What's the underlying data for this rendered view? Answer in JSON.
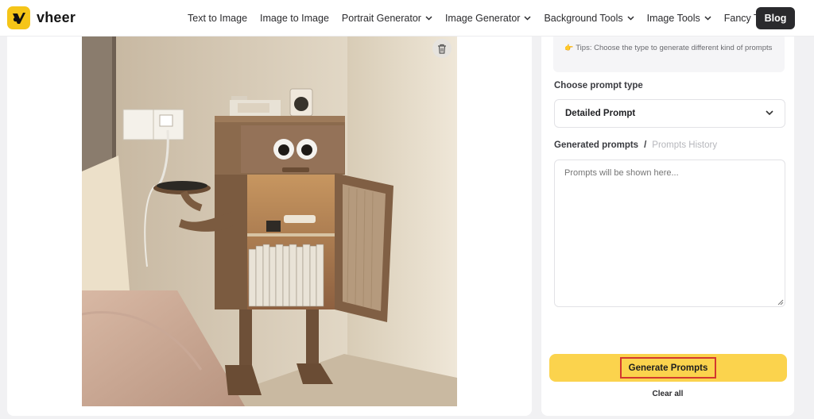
{
  "brand": {
    "name": "vheer",
    "accent": "#f5c518"
  },
  "nav": {
    "items": [
      {
        "label": "Text to Image",
        "dropdown": false
      },
      {
        "label": "Image to Image",
        "dropdown": false
      },
      {
        "label": "Portrait Generator",
        "dropdown": true
      },
      {
        "label": "Image Generator",
        "dropdown": true
      },
      {
        "label": "Background Tools",
        "dropdown": true
      },
      {
        "label": "Image Tools",
        "dropdown": true
      },
      {
        "label": "Fancy Text",
        "dropdown": true
      }
    ],
    "blog_label": "Blog"
  },
  "upload": {
    "image_description": "uploaded-photo-wooden-nightstand",
    "delete_icon": "trash-icon"
  },
  "panel": {
    "tips_text": "Tips: Choose the type to generate different kind of prompts",
    "prompt_type_label": "Choose prompt type",
    "prompt_type_value": "Detailed Prompt",
    "generated_tab": "Generated prompts",
    "tab_separator": "/",
    "history_tab": "Prompts History",
    "output_placeholder": "Prompts will be shown here...",
    "generate_label": "Generate Prompts",
    "clear_label": "Clear all"
  },
  "colors": {
    "generate_button": "#fbd34d",
    "highlight_border": "#d3382f",
    "blog_button": "#2a2a2d"
  }
}
